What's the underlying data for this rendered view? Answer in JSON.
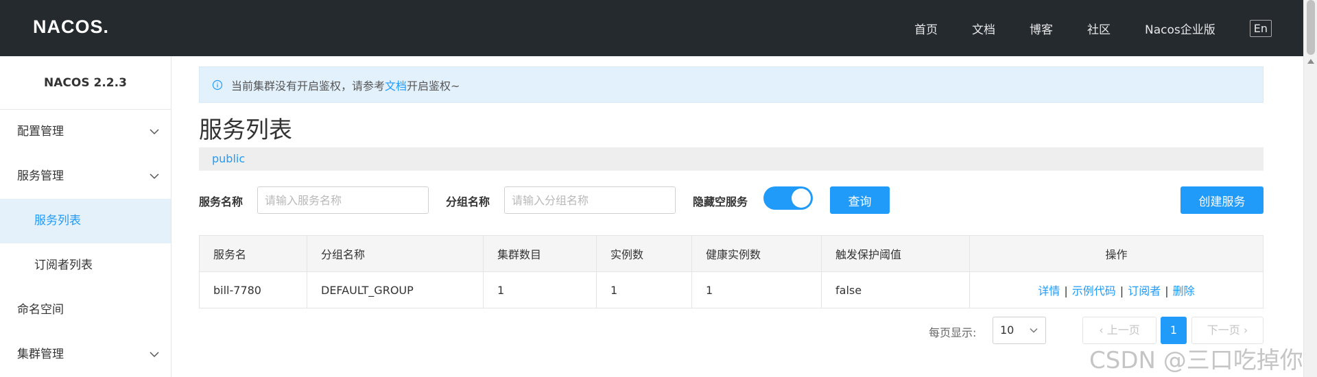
{
  "header": {
    "logo_text": "NACOS.",
    "nav": [
      "首页",
      "文档",
      "博客",
      "社区",
      "Nacos企业版"
    ],
    "lang_button": "En"
  },
  "sidebar": {
    "title": "NACOS 2.2.3",
    "items": [
      {
        "label": "配置管理",
        "expandable": true
      },
      {
        "label": "服务管理",
        "expandable": true
      },
      {
        "label": "服务列表",
        "active": true
      },
      {
        "label": "订阅者列表"
      },
      {
        "label": "命名空间"
      },
      {
        "label": "集群管理",
        "expandable": true
      }
    ]
  },
  "notice": {
    "prefix": "当前集群没有开启鉴权，请参考",
    "link": "文档",
    "suffix": "开启鉴权~"
  },
  "page_title": "服务列表",
  "namespace": "public",
  "filter": {
    "service_name_label": "服务名称",
    "service_name_placeholder": "请输入服务名称",
    "group_name_label": "分组名称",
    "group_name_placeholder": "请输入分组名称",
    "hide_empty_label": "隐藏空服务",
    "hide_empty_on": true,
    "search_button": "查询",
    "create_button": "创建服务"
  },
  "table": {
    "columns": [
      "服务名",
      "分组名称",
      "集群数目",
      "实例数",
      "健康实例数",
      "触发保护阈值",
      "操作"
    ],
    "rows": [
      {
        "service": "bill-7780",
        "group": "DEFAULT_GROUP",
        "clusters": "1",
        "instances": "1",
        "healthy": "1",
        "threshold": "false",
        "ops": [
          "详情",
          "示例代码",
          "订阅者",
          "删除"
        ]
      }
    ]
  },
  "pagination": {
    "page_size_label": "每页显示:",
    "page_size": "10",
    "prev": "上一页",
    "current": "1",
    "next": "下一页"
  },
  "watermark": "CSDN @三口吃掉你",
  "colors": {
    "accent": "#209bfa",
    "topbar": "#252a2f",
    "notice_bg": "#e3f1fc"
  }
}
